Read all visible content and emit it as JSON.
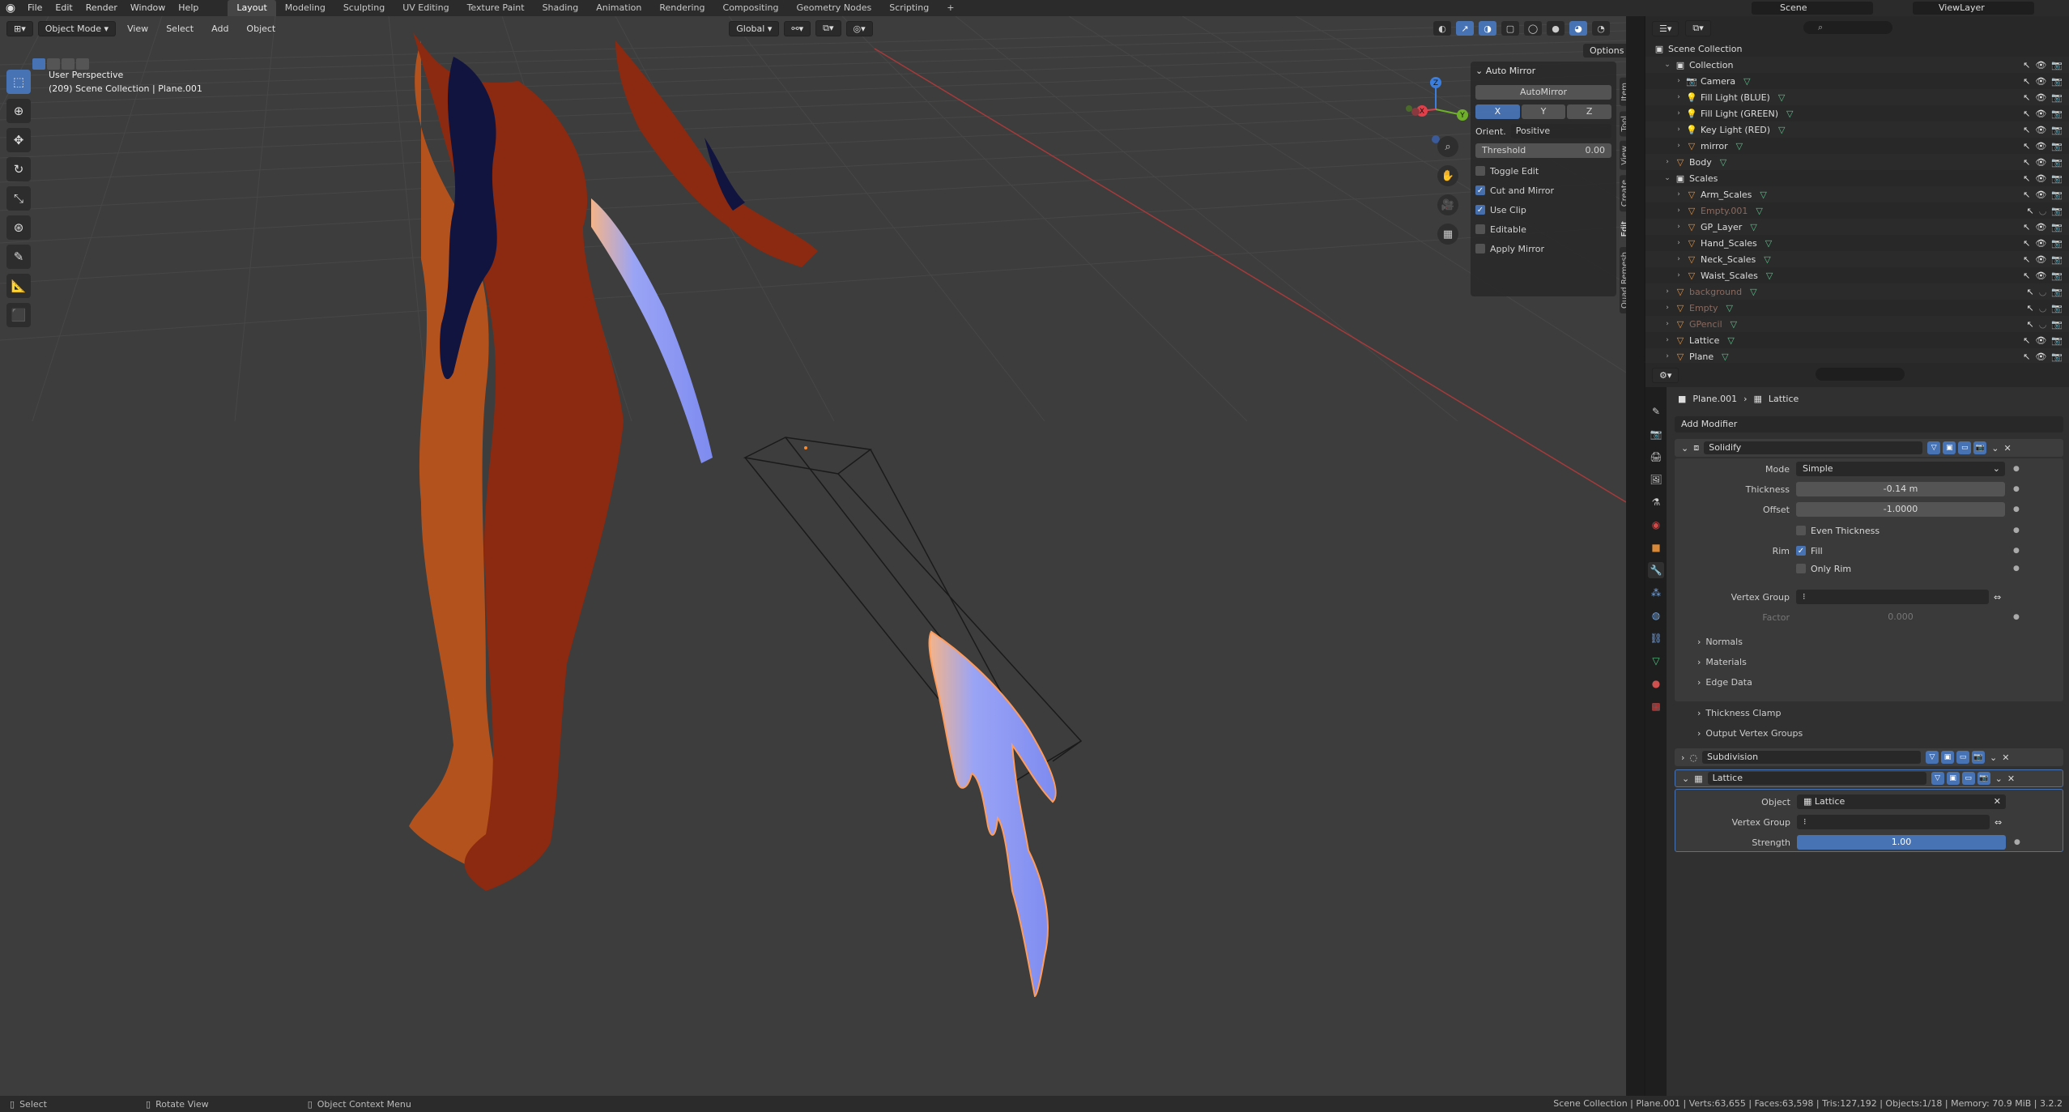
{
  "topbar": {
    "menus": [
      "File",
      "Edit",
      "Render",
      "Window",
      "Help"
    ],
    "workspaces": [
      "Layout",
      "Modeling",
      "Sculpting",
      "UV Editing",
      "Texture Paint",
      "Shading",
      "Animation",
      "Rendering",
      "Compositing",
      "Geometry Nodes",
      "Scripting"
    ],
    "active_workspace": "Layout",
    "add_tab": "+",
    "scene": "Scene",
    "view_layer": "ViewLayer"
  },
  "viewport": {
    "mode": "Object Mode",
    "menus": [
      "View",
      "Select",
      "Add",
      "Object"
    ],
    "transform_orientation": "Global",
    "options": "Options",
    "info_line1": "User Perspective",
    "info_line2": "(209) Scene Collection | Plane.001",
    "gizmo_x": "X",
    "gizmo_y": "Y",
    "gizmo_z": "Z"
  },
  "npanel": {
    "title": "Auto Mirror",
    "button": "AutoMirror",
    "axes": [
      "X",
      "Y",
      "Z"
    ],
    "orient_label": "Orient.",
    "orient_value": "Positive",
    "threshold_label": "Threshold",
    "threshold_value": "0.00",
    "toggle_edit": "Toggle Edit",
    "cut_and_mirror": "Cut and Mirror",
    "use_clip": "Use Clip",
    "editable": "Editable",
    "apply_mirror": "Apply Mirror",
    "tabs": [
      "Item",
      "Tool",
      "View",
      "Create",
      "Edit",
      "Quad Remesh"
    ]
  },
  "outliner": {
    "root": "Scene Collection",
    "rows": [
      {
        "label": "Collection",
        "indent": 1,
        "kind": "collection"
      },
      {
        "label": "Camera",
        "indent": 2,
        "kind": "object"
      },
      {
        "label": "Fill Light (BLUE)",
        "indent": 2,
        "kind": "object"
      },
      {
        "label": "Fill Light (GREEN)",
        "indent": 2,
        "kind": "object"
      },
      {
        "label": "Key Light (RED)",
        "indent": 2,
        "kind": "object"
      },
      {
        "label": "mirror",
        "indent": 2,
        "kind": "object"
      },
      {
        "label": "Body",
        "indent": 1,
        "kind": "object"
      },
      {
        "label": "Scales",
        "indent": 1,
        "kind": "collection"
      },
      {
        "label": "Arm_Scales",
        "indent": 2,
        "kind": "object"
      },
      {
        "label": "Empty.001",
        "indent": 2,
        "kind": "dim"
      },
      {
        "label": "GP_Layer",
        "indent": 2,
        "kind": "object"
      },
      {
        "label": "Hand_Scales",
        "indent": 2,
        "kind": "object"
      },
      {
        "label": "Neck_Scales",
        "indent": 2,
        "kind": "object"
      },
      {
        "label": "Waist_Scales",
        "indent": 2,
        "kind": "object"
      },
      {
        "label": "background",
        "indent": 1,
        "kind": "dim"
      },
      {
        "label": "Empty",
        "indent": 1,
        "kind": "dim"
      },
      {
        "label": "GPencil",
        "indent": 1,
        "kind": "dim"
      },
      {
        "label": "Lattice",
        "indent": 1,
        "kind": "object"
      },
      {
        "label": "Plane",
        "indent": 1,
        "kind": "object"
      }
    ]
  },
  "properties": {
    "breadcrumb_object": "Plane.001",
    "breadcrumb_modifier": "Lattice",
    "add_modifier": "Add Modifier",
    "solidify": {
      "name": "Solidify",
      "mode_label": "Mode",
      "mode_value": "Simple",
      "thickness_label": "Thickness",
      "thickness_value": "-0.14 m",
      "offset_label": "Offset",
      "offset_value": "-1.0000",
      "even_thickness": "Even Thickness",
      "rim_label": "Rim",
      "fill": "Fill",
      "only_rim": "Only Rim",
      "vertex_group_label": "Vertex Group",
      "factor_label": "Factor",
      "factor_value": "0.000",
      "subpanels": [
        "Normals",
        "Materials",
        "Edge Data",
        "Thickness Clamp",
        "Output Vertex Groups"
      ]
    },
    "subdivision": {
      "name": "Subdivision"
    },
    "lattice": {
      "name": "Lattice",
      "object_label": "Object",
      "object_value": "Lattice",
      "vertex_group_label": "Vertex Group",
      "strength_label": "Strength",
      "strength_value": "1.00"
    }
  },
  "statusbar": {
    "select": "Select",
    "rotate": "Rotate View",
    "context": "Object Context Menu",
    "stats": "Scene Collection | Plane.001 | Verts:63,655 | Faces:63,598 | Tris:127,192 | Objects:1/18 | Memory: 70.9 MiB | 3.2.2"
  },
  "colors": {
    "accent": "#4772b3",
    "body_red": "#8b2a10",
    "body_orange": "#b4521e",
    "body_navy": "#121440",
    "scale_blue": "#9aa4f5"
  }
}
